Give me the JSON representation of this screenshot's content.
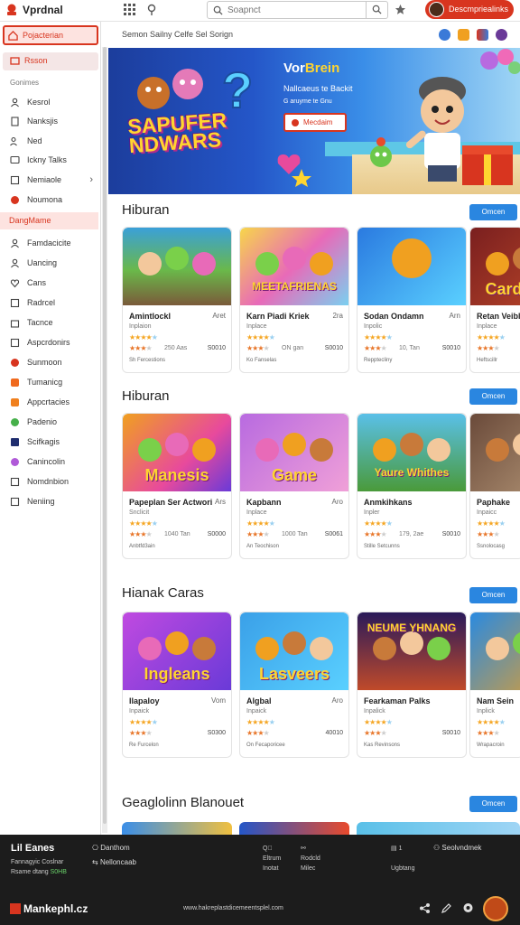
{
  "topbar": {
    "title": "Vprdnal",
    "search_placeholder": "Soapnct",
    "user_label": "Descmpriealinks"
  },
  "sidebar": {
    "top_button": "Pojacterian",
    "selected": "Rsson",
    "section_label": "Gonimes",
    "items_a": [
      "Kesrol",
      "Nanksjis",
      "Ned",
      "Ickny Talks",
      "Nemiaole"
    ],
    "highlight": "DangMame",
    "items_b": [
      "Famdacicite",
      "Uancing",
      "Cans",
      "Radrcel",
      "Tacnce",
      "Aspcrdonirs",
      "Sunmoon",
      "Tumanicg",
      "Appcrtacies",
      "Padenio",
      "Scifkagis",
      "Canincolin",
      "Nomdnbion",
      "Neniing"
    ]
  },
  "main": {
    "crumb": "Semon Sailny Celfe Sel Sorign",
    "hero": {
      "game_title": "SAPUFER NDWARS",
      "heading_a": "Vor",
      "heading_b": "Brein",
      "sub": "Nallcaeus te Backit",
      "sub2": "G aruyme te Gnu",
      "button": "Mecdaim"
    },
    "sections": [
      {
        "title": "Hiburan",
        "button": "Omcen"
      },
      {
        "title": "Hiburan",
        "button": "Omcen"
      },
      {
        "title": "Hianak Caras",
        "button": "Omcen"
      },
      {
        "title": "Geaglolinn Blanouet",
        "button": "Omcen"
      }
    ],
    "rows": [
      [
        {
          "name": "Amintlockl",
          "tag": "Aret",
          "sub": "Inplaion",
          "score": "250 Aas",
          "price": "S0010",
          "foot": "Sh Fercestions",
          "thumb": ""
        },
        {
          "name": "Karn Piadi Kriek",
          "tag": "2ra",
          "sub": "Inplace",
          "score": "ON gan",
          "price": "S0010",
          "foot": "Ko Fanselas",
          "thumb": "MEETAFRIENAS"
        },
        {
          "name": "Sodan Ondamn",
          "tag": "Arn",
          "sub": "Inpolic",
          "score": "10, Tan",
          "price": "S0010",
          "foot": "Repptecliny",
          "thumb": ""
        },
        {
          "name": "Retan Veibl",
          "tag": "",
          "sub": "Inplace",
          "score": "",
          "price": "",
          "foot": "Heftscillr",
          "thumb": "Cardinalle"
        }
      ],
      [
        {
          "name": "Papeplan Ser Actwori",
          "tag": "Ars",
          "sub": "Snclicit",
          "score": "1040 Tan",
          "price": "S0000",
          "foot": "Anbtfd3ain",
          "thumb": "Manesis"
        },
        {
          "name": "Kapbann",
          "tag": "Aro",
          "sub": "Inplace",
          "score": "1000 Tan",
          "price": "S0061",
          "foot": "An Teochison",
          "thumb": "Game"
        },
        {
          "name": "Anmkihkans",
          "tag": "",
          "sub": "Inpler",
          "score": "179, 2ae",
          "price": "S0010",
          "foot": "Stille Setcunns",
          "thumb": "Yaure Whithes"
        },
        {
          "name": "Paphake",
          "tag": "",
          "sub": "Inpaicc",
          "score": "",
          "price": "",
          "foot": "Ssnolocasg",
          "thumb": ""
        }
      ],
      [
        {
          "name": "Ilapaloy",
          "tag": "Vom",
          "sub": "Inpaick",
          "score": "",
          "price": "S0300",
          "foot": "Re Furcelon",
          "thumb": "Ingleans"
        },
        {
          "name": "Algbal",
          "tag": "Aro",
          "sub": "Inpaick",
          "score": "",
          "price": "40010",
          "foot": "On Fecaporicee",
          "thumb": "Lasveers"
        },
        {
          "name": "Fearkaman Palks",
          "tag": "",
          "sub": "Inpalick",
          "score": "",
          "price": "S0010",
          "foot": "Kas Revinsons",
          "thumb": "NEUME YHNANG"
        },
        {
          "name": "Nam Sein",
          "tag": "",
          "sub": "Inplick",
          "score": "",
          "price": "",
          "foot": "Wrapacroin",
          "thumb": ""
        }
      ]
    ]
  },
  "footer": {
    "brand": "Lil Eanes",
    "line1": "Fannagyic Coslnar",
    "line2a": "Rsame dtang",
    "line2b": "S0HB",
    "link1": "Danthom",
    "link2": "Nelloncaab",
    "col1a": "Eltrum",
    "col1b": "Inotat",
    "col2a": "Rodcld",
    "col2b": "Milec",
    "col3a": "1",
    "col3b": "Ugbtang",
    "link3": "Seolvndmek",
    "logo": "Mankephl.cz",
    "url": "www.hakreplastdicemeentsplel.com"
  },
  "colors": {
    "accent": "#d8351f",
    "button_blue": "#2a86e0",
    "footer_bg": "#1c1c1c",
    "star": "#f5a623"
  }
}
